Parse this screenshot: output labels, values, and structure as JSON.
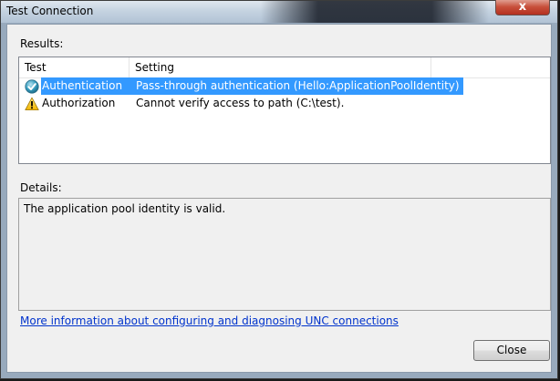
{
  "window": {
    "title": "Test Connection",
    "close_glyph": "x"
  },
  "results": {
    "label": "Results:",
    "columns": [
      "Test",
      "Setting"
    ],
    "rows": [
      {
        "icon": "success-check-icon",
        "test": "Authentication",
        "setting": "Pass-through authentication (Hello:ApplicationPoolIdentity)",
        "selected": true
      },
      {
        "icon": "warning-icon",
        "test": "Authorization",
        "setting": "Cannot verify access to path (C:\\test).",
        "selected": false
      }
    ]
  },
  "details": {
    "label": "Details:",
    "text": "The application pool identity is valid."
  },
  "link": {
    "text": "More information about configuring and diagnosing UNC connections"
  },
  "buttons": {
    "close": "Close"
  },
  "colors": {
    "selection": "#3399ff",
    "link": "#0033cc"
  }
}
